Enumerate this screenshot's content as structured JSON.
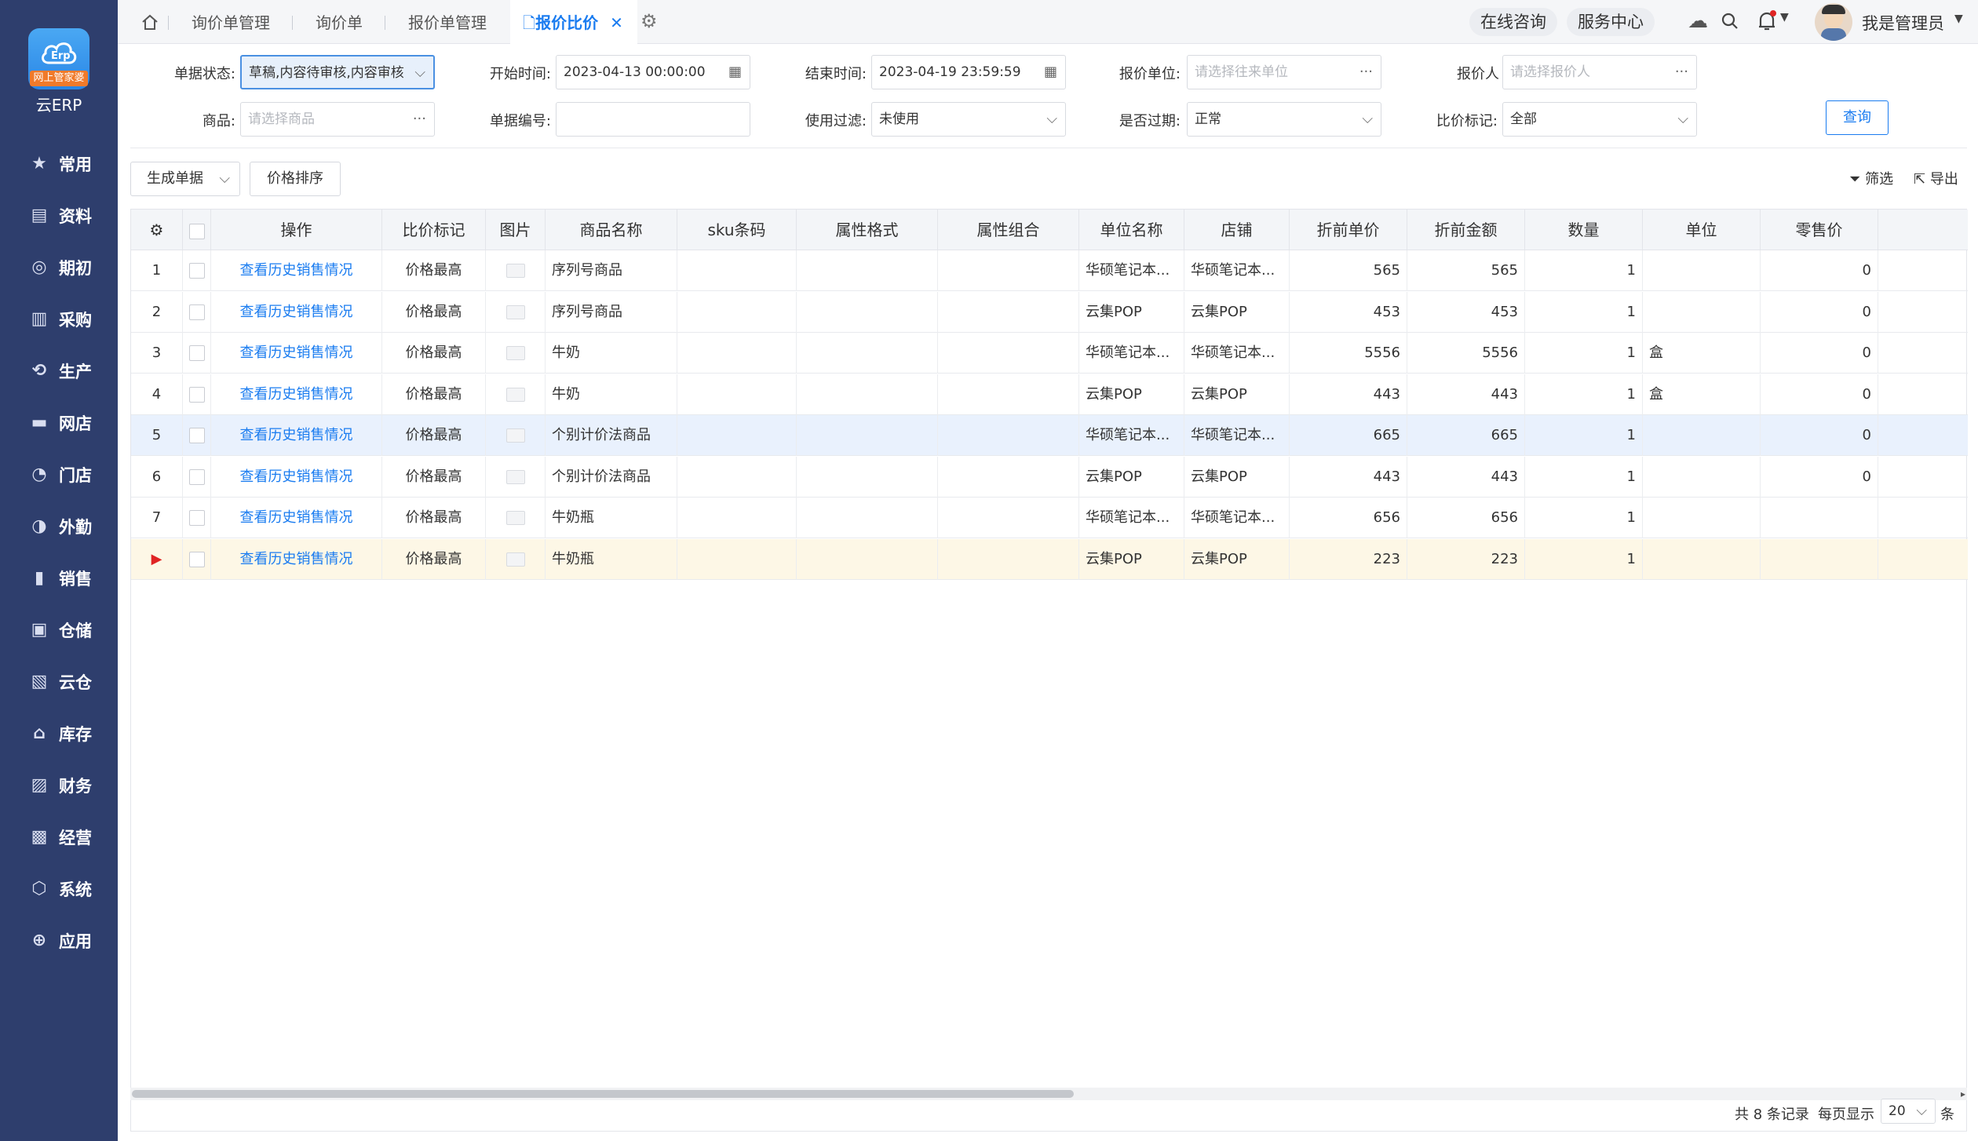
{
  "brand": {
    "badge": "网上管家婆",
    "name": "云ERP"
  },
  "sidebar": {
    "items": [
      {
        "label": "常用",
        "icon": "star-icon"
      },
      {
        "label": "资料",
        "icon": "document-icon"
      },
      {
        "label": "期初",
        "icon": "target-icon"
      },
      {
        "label": "采购",
        "icon": "cart-icon"
      },
      {
        "label": "生产",
        "icon": "production-icon"
      },
      {
        "label": "网店",
        "icon": "shop-icon"
      },
      {
        "label": "门店",
        "icon": "pie-icon"
      },
      {
        "label": "外勤",
        "icon": "field-icon"
      },
      {
        "label": "销售",
        "icon": "sales-icon"
      },
      {
        "label": "仓储",
        "icon": "warehouse-icon"
      },
      {
        "label": "云仓",
        "icon": "cloud-warehouse-icon"
      },
      {
        "label": "库存",
        "icon": "inventory-icon"
      },
      {
        "label": "财务",
        "icon": "finance-icon"
      },
      {
        "label": "经营",
        "icon": "business-icon"
      },
      {
        "label": "系统",
        "icon": "system-icon"
      },
      {
        "label": "应用",
        "icon": "plus-icon"
      }
    ]
  },
  "topbar": {
    "tabs": [
      "询价单管理",
      "询价单",
      "报价单管理",
      "报价比价"
    ],
    "online": "在线咨询",
    "service": "服务中心",
    "user": "我是管理员"
  },
  "filters": {
    "status_label": "单据状态:",
    "status_value": "草稿,内容待审核,内容审核",
    "start_label": "开始时间:",
    "start_value": "2023-04-13 00:00:00",
    "end_label": "结束时间:",
    "end_value": "2023-04-19 23:59:59",
    "unit_label": "报价单位:",
    "unit_placeholder": "请选择往来单位",
    "person_label": "报价人",
    "person_placeholder": "请选择报价人",
    "goods_label": "商品:",
    "goods_placeholder": "请选择商品",
    "billno_label": "单据编号:",
    "usefilter_label": "使用过滤:",
    "usefilter_value": "未使用",
    "expired_label": "是否过期:",
    "expired_value": "正常",
    "compare_label": "比价标记:",
    "compare_value": "全部",
    "query": "查询"
  },
  "actions": {
    "generate": "生成单据",
    "sort": "价格排序",
    "filter": "筛选",
    "export": "导出"
  },
  "table": {
    "headers": [
      "操作",
      "比价标记",
      "图片",
      "商品名称",
      "sku条码",
      "属性格式",
      "属性组合",
      "单位名称",
      "店铺",
      "折前单价",
      "折前金额",
      "数量",
      "单位",
      "零售价"
    ],
    "rows": [
      {
        "no": "1",
        "op": "查看历史销售情况",
        "mark": "价格最高",
        "name": "序列号商品",
        "unitname": "华硕笔记本...",
        "shop": "华硕笔记本...",
        "price": "565",
        "amount": "565",
        "qty": "1",
        "unit": "",
        "retail": "0"
      },
      {
        "no": "2",
        "op": "查看历史销售情况",
        "mark": "价格最高",
        "name": "序列号商品",
        "unitname": "云集POP",
        "shop": "云集POP",
        "price": "453",
        "amount": "453",
        "qty": "1",
        "unit": "",
        "retail": "0"
      },
      {
        "no": "3",
        "op": "查看历史销售情况",
        "mark": "价格最高",
        "name": "牛奶",
        "unitname": "华硕笔记本...",
        "shop": "华硕笔记本...",
        "price": "5556",
        "amount": "5556",
        "qty": "1",
        "unit": "盒",
        "retail": "0"
      },
      {
        "no": "4",
        "op": "查看历史销售情况",
        "mark": "价格最高",
        "name": "牛奶",
        "unitname": "云集POP",
        "shop": "云集POP",
        "price": "443",
        "amount": "443",
        "qty": "1",
        "unit": "盒",
        "retail": "0"
      },
      {
        "no": "5",
        "op": "查看历史销售情况",
        "mark": "价格最高",
        "name": "个别计价法商品",
        "unitname": "华硕笔记本...",
        "shop": "华硕笔记本...",
        "price": "665",
        "amount": "665",
        "qty": "1",
        "unit": "",
        "retail": "0"
      },
      {
        "no": "6",
        "op": "查看历史销售情况",
        "mark": "价格最高",
        "name": "个别计价法商品",
        "unitname": "云集POP",
        "shop": "云集POP",
        "price": "443",
        "amount": "443",
        "qty": "1",
        "unit": "",
        "retail": "0"
      },
      {
        "no": "7",
        "op": "查看历史销售情况",
        "mark": "价格最高",
        "name": "牛奶瓶",
        "unitname": "华硕笔记本...",
        "shop": "华硕笔记本...",
        "price": "656",
        "amount": "656",
        "qty": "1",
        "unit": "",
        "retail": ""
      },
      {
        "no": "▶",
        "op": "查看历史销售情况",
        "mark": "价格最高",
        "name": "牛奶瓶",
        "unitname": "云集POP",
        "shop": "云集POP",
        "price": "223",
        "amount": "223",
        "qty": "1",
        "unit": "",
        "retail": ""
      }
    ]
  },
  "footer": {
    "total": "共 8 条记录",
    "perpage_label": "每页显示",
    "perpage": "20",
    "unit": "条"
  }
}
